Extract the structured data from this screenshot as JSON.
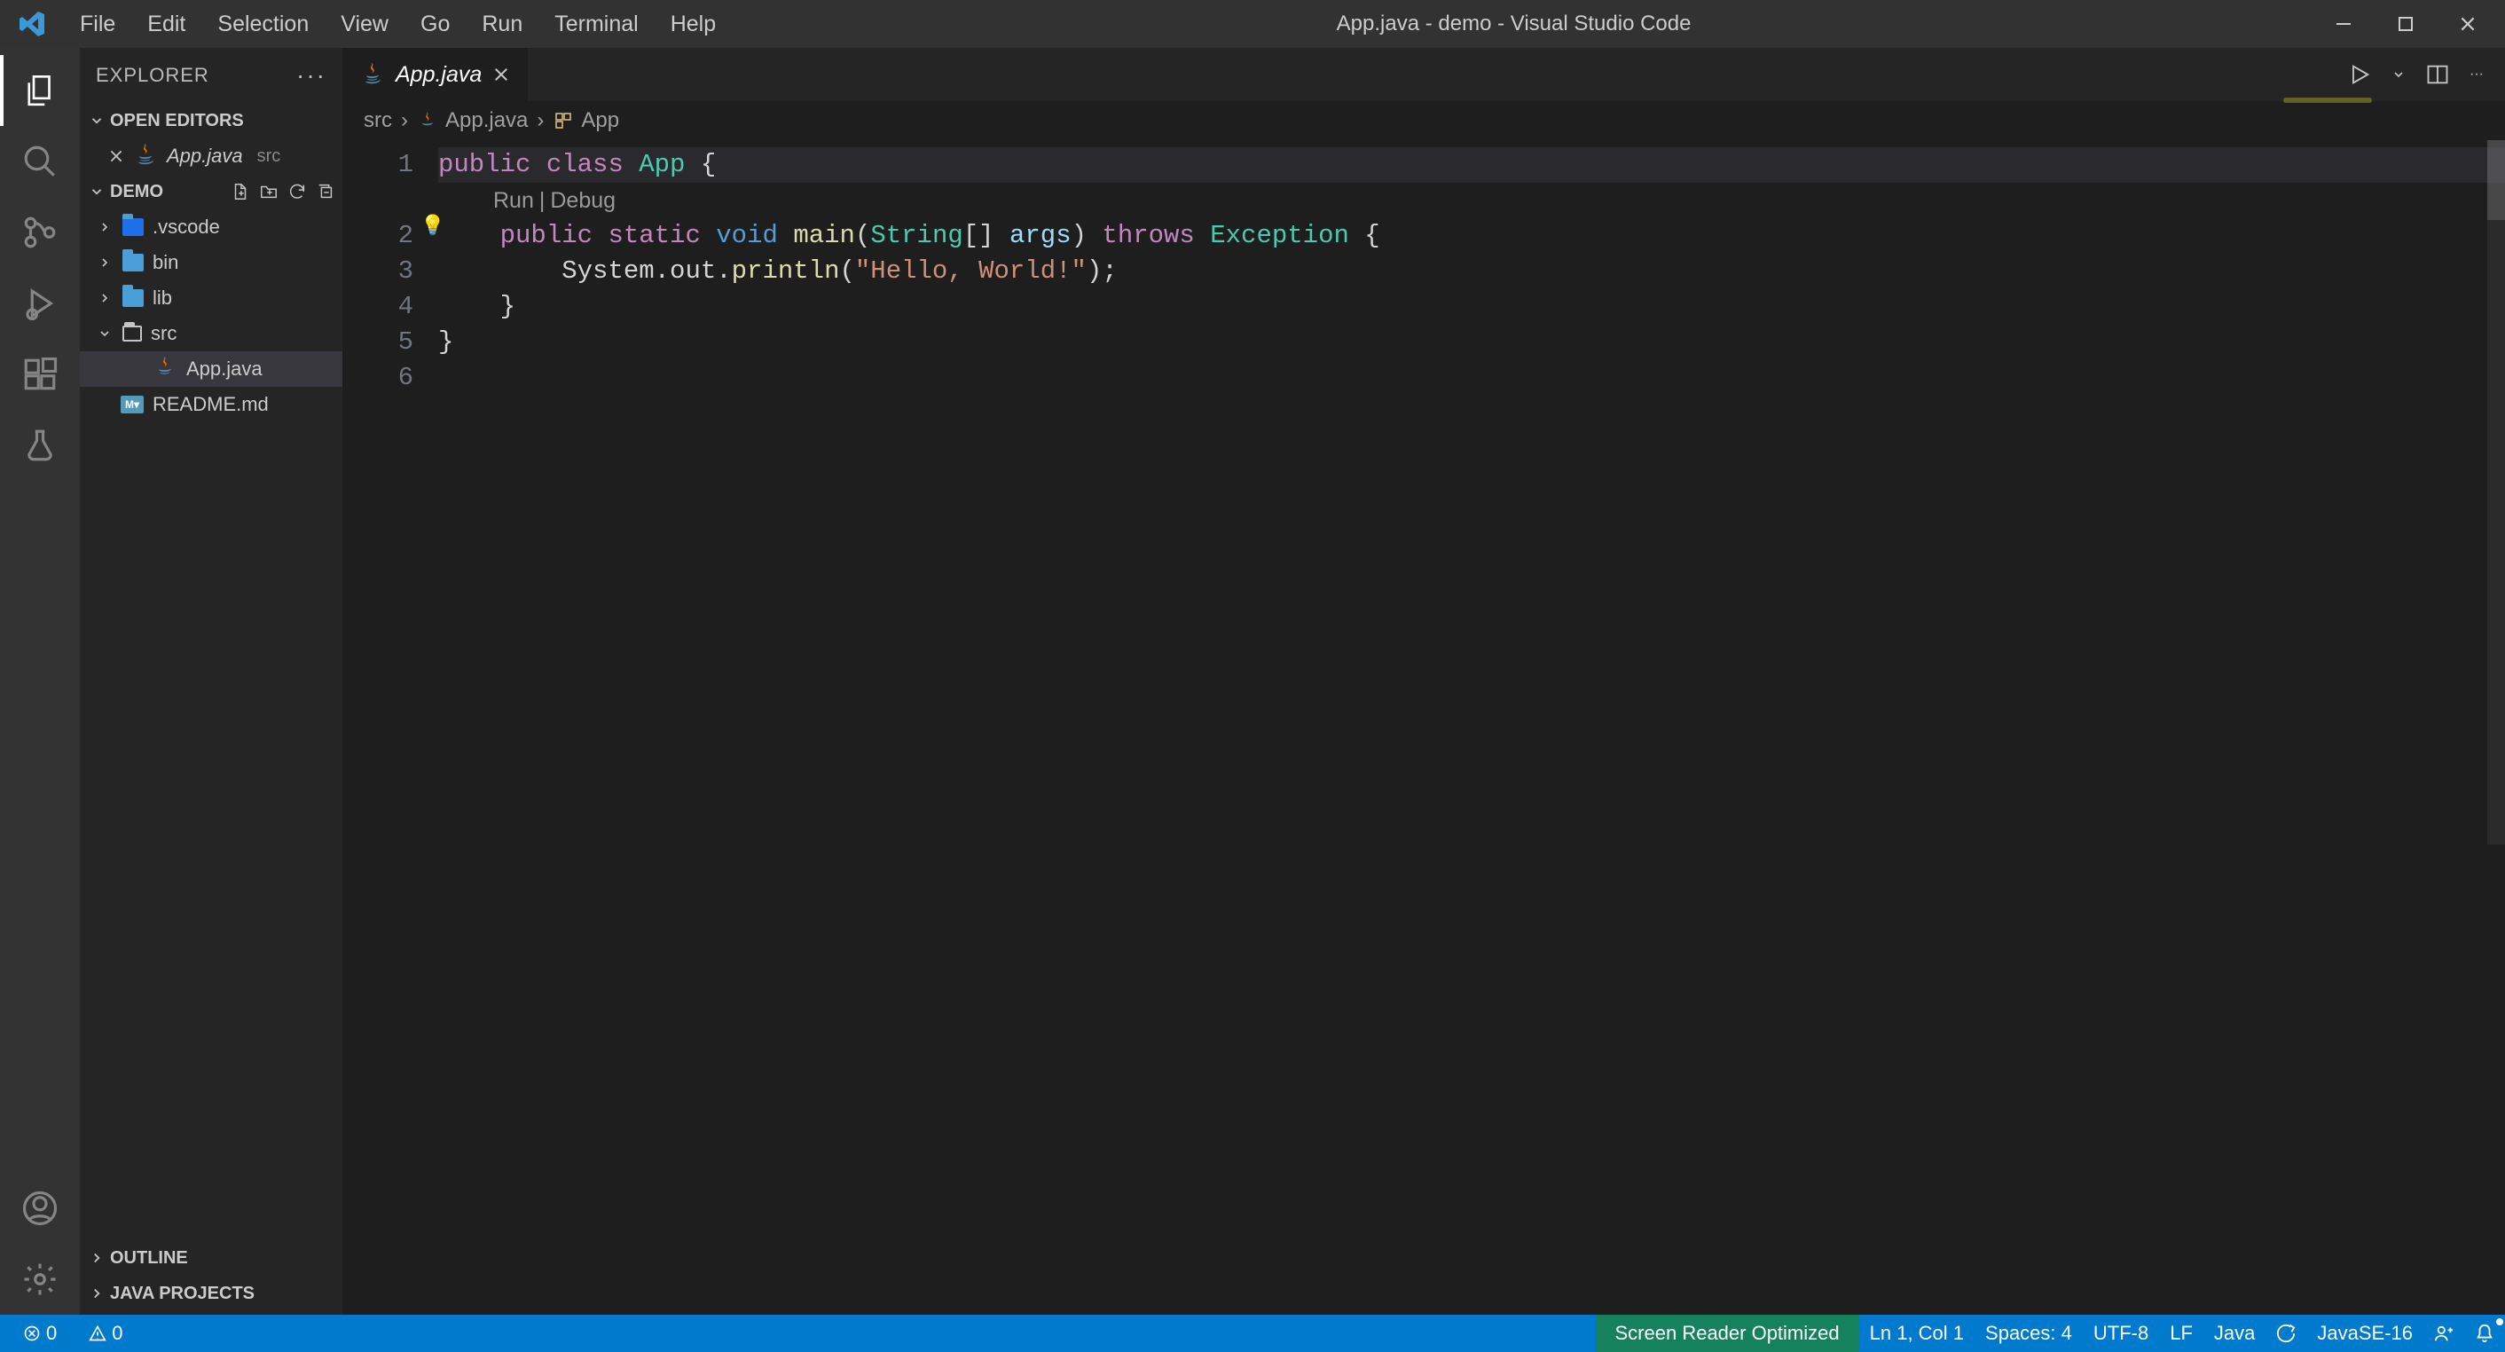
{
  "titlebar": {
    "menus": [
      "File",
      "Edit",
      "Selection",
      "View",
      "Go",
      "Run",
      "Terminal",
      "Help"
    ],
    "title": "App.java - demo - Visual Studio Code"
  },
  "sidebar": {
    "title": "EXPLORER",
    "openEditors": {
      "label": "OPEN EDITORS",
      "items": [
        {
          "name": "App.java",
          "trail": "src"
        }
      ]
    },
    "workspace": {
      "name": "DEMO",
      "tree": [
        {
          "name": ".vscode",
          "kind": "folder-vscode",
          "depth": 1,
          "expanded": false
        },
        {
          "name": "bin",
          "kind": "folder",
          "depth": 1,
          "expanded": false
        },
        {
          "name": "lib",
          "kind": "folder",
          "depth": 1,
          "expanded": false
        },
        {
          "name": "src",
          "kind": "folder-open",
          "depth": 1,
          "expanded": true
        },
        {
          "name": "App.java",
          "kind": "java",
          "depth": 2,
          "active": true
        },
        {
          "name": "README.md",
          "kind": "md",
          "depth": 1
        }
      ]
    },
    "outline": "OUTLINE",
    "javaProjects": "JAVA PROJECTS"
  },
  "editor": {
    "tab": {
      "name": "App.java"
    },
    "breadcrumb": {
      "parts": [
        "src",
        "App.java",
        "App"
      ]
    },
    "codelens": {
      "run": "Run",
      "debug": "Debug"
    },
    "lines": [
      {
        "n": 1,
        "tokens": [
          [
            "tok-kw",
            "public"
          ],
          [
            "tok-default",
            " "
          ],
          [
            "tok-kw",
            "class"
          ],
          [
            "tok-default",
            " "
          ],
          [
            "tok-type",
            "App"
          ],
          [
            "tok-default",
            " {"
          ]
        ]
      },
      {
        "n": 2,
        "tokens": [
          [
            "tok-default",
            "    "
          ],
          [
            "tok-kw",
            "public"
          ],
          [
            "tok-default",
            " "
          ],
          [
            "tok-kw",
            "static"
          ],
          [
            "tok-default",
            " "
          ],
          [
            "tok-mod",
            "void"
          ],
          [
            "tok-default",
            " "
          ],
          [
            "tok-fn",
            "main"
          ],
          [
            "tok-default",
            "("
          ],
          [
            "tok-type",
            "String"
          ],
          [
            "tok-default",
            "[] "
          ],
          [
            "tok-var",
            "args"
          ],
          [
            "tok-default",
            ") "
          ],
          [
            "tok-kw",
            "throws"
          ],
          [
            "tok-default",
            " "
          ],
          [
            "tok-type",
            "Exception"
          ],
          [
            "tok-default",
            " {"
          ]
        ]
      },
      {
        "n": 3,
        "tokens": [
          [
            "tok-default",
            "        System.out."
          ],
          [
            "tok-fn",
            "println"
          ],
          [
            "tok-default",
            "("
          ],
          [
            "tok-str",
            "\"Hello, World!\""
          ],
          [
            "tok-default",
            ");"
          ]
        ]
      },
      {
        "n": 4,
        "tokens": [
          [
            "tok-default",
            "    }"
          ]
        ]
      },
      {
        "n": 5,
        "tokens": [
          [
            "tok-default",
            "}"
          ]
        ]
      },
      {
        "n": 6,
        "tokens": []
      }
    ]
  },
  "status": {
    "errors": "0",
    "warnings": "0",
    "screenReader": "Screen Reader Optimized",
    "lncol": "Ln 1, Col 1",
    "spaces": "Spaces: 4",
    "encoding": "UTF-8",
    "eol": "LF",
    "lang": "Java",
    "jdk": "JavaSE-16"
  }
}
